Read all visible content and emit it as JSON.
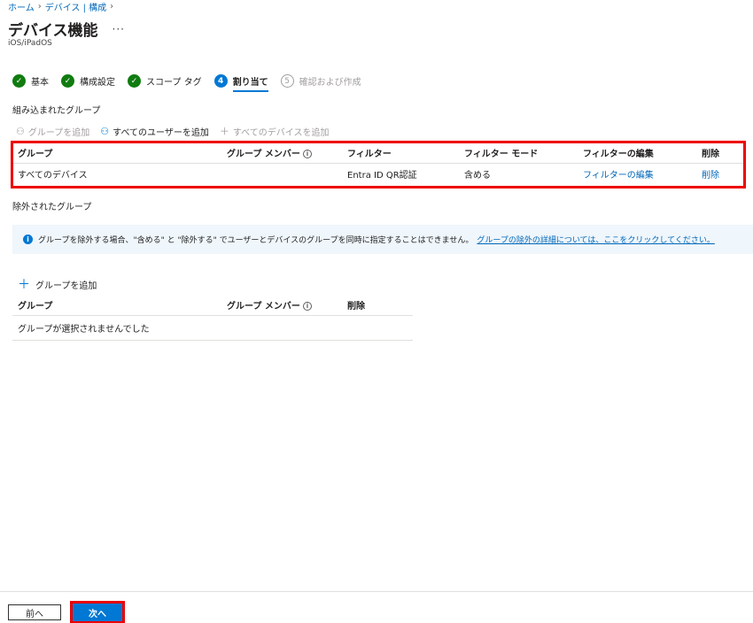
{
  "breadcrumb": {
    "home": "ホーム",
    "device_config": "デバイス | 構成"
  },
  "page": {
    "title": "デバイス機能",
    "more": "···",
    "subtitle": "iOS/iPadOS"
  },
  "steps": [
    {
      "num": "✓",
      "label": "基本"
    },
    {
      "num": "✓",
      "label": "構成設定"
    },
    {
      "num": "✓",
      "label": "スコープ タグ"
    },
    {
      "num": "4",
      "label": "割り当て"
    },
    {
      "num": "5",
      "label": "確認および作成"
    }
  ],
  "included": {
    "title": "組み込まれたグループ",
    "toolbar": {
      "add_group": "グループを追加",
      "add_all_users": "すべてのユーザーを追加",
      "add_all_devices": "すべてのデバイスを追加"
    },
    "headers": {
      "group": "グループ",
      "members": "グループ メンバー",
      "filter": "フィルター",
      "filter_mode": "フィルター モード",
      "edit_filter": "フィルターの編集",
      "delete": "削除"
    },
    "row": {
      "group": "すべてのデバイス",
      "filter": "Entra ID QR認証",
      "filter_mode": "含める",
      "edit_filter": "フィルターの編集",
      "delete": "削除"
    }
  },
  "excluded": {
    "title": "除外されたグループ",
    "info": "グループを除外する場合、\"含める\" と \"除外する\" でユーザーとデバイスのグループを同時に指定することはできません。",
    "info_link": "グループの除外の詳細については、ここをクリックしてください。",
    "add_group": "グループを追加",
    "headers": {
      "group": "グループ",
      "members": "グループ メンバー",
      "delete": "削除"
    },
    "empty": "グループが選択されませんでした"
  },
  "footer": {
    "prev": "前へ",
    "next": "次へ"
  }
}
